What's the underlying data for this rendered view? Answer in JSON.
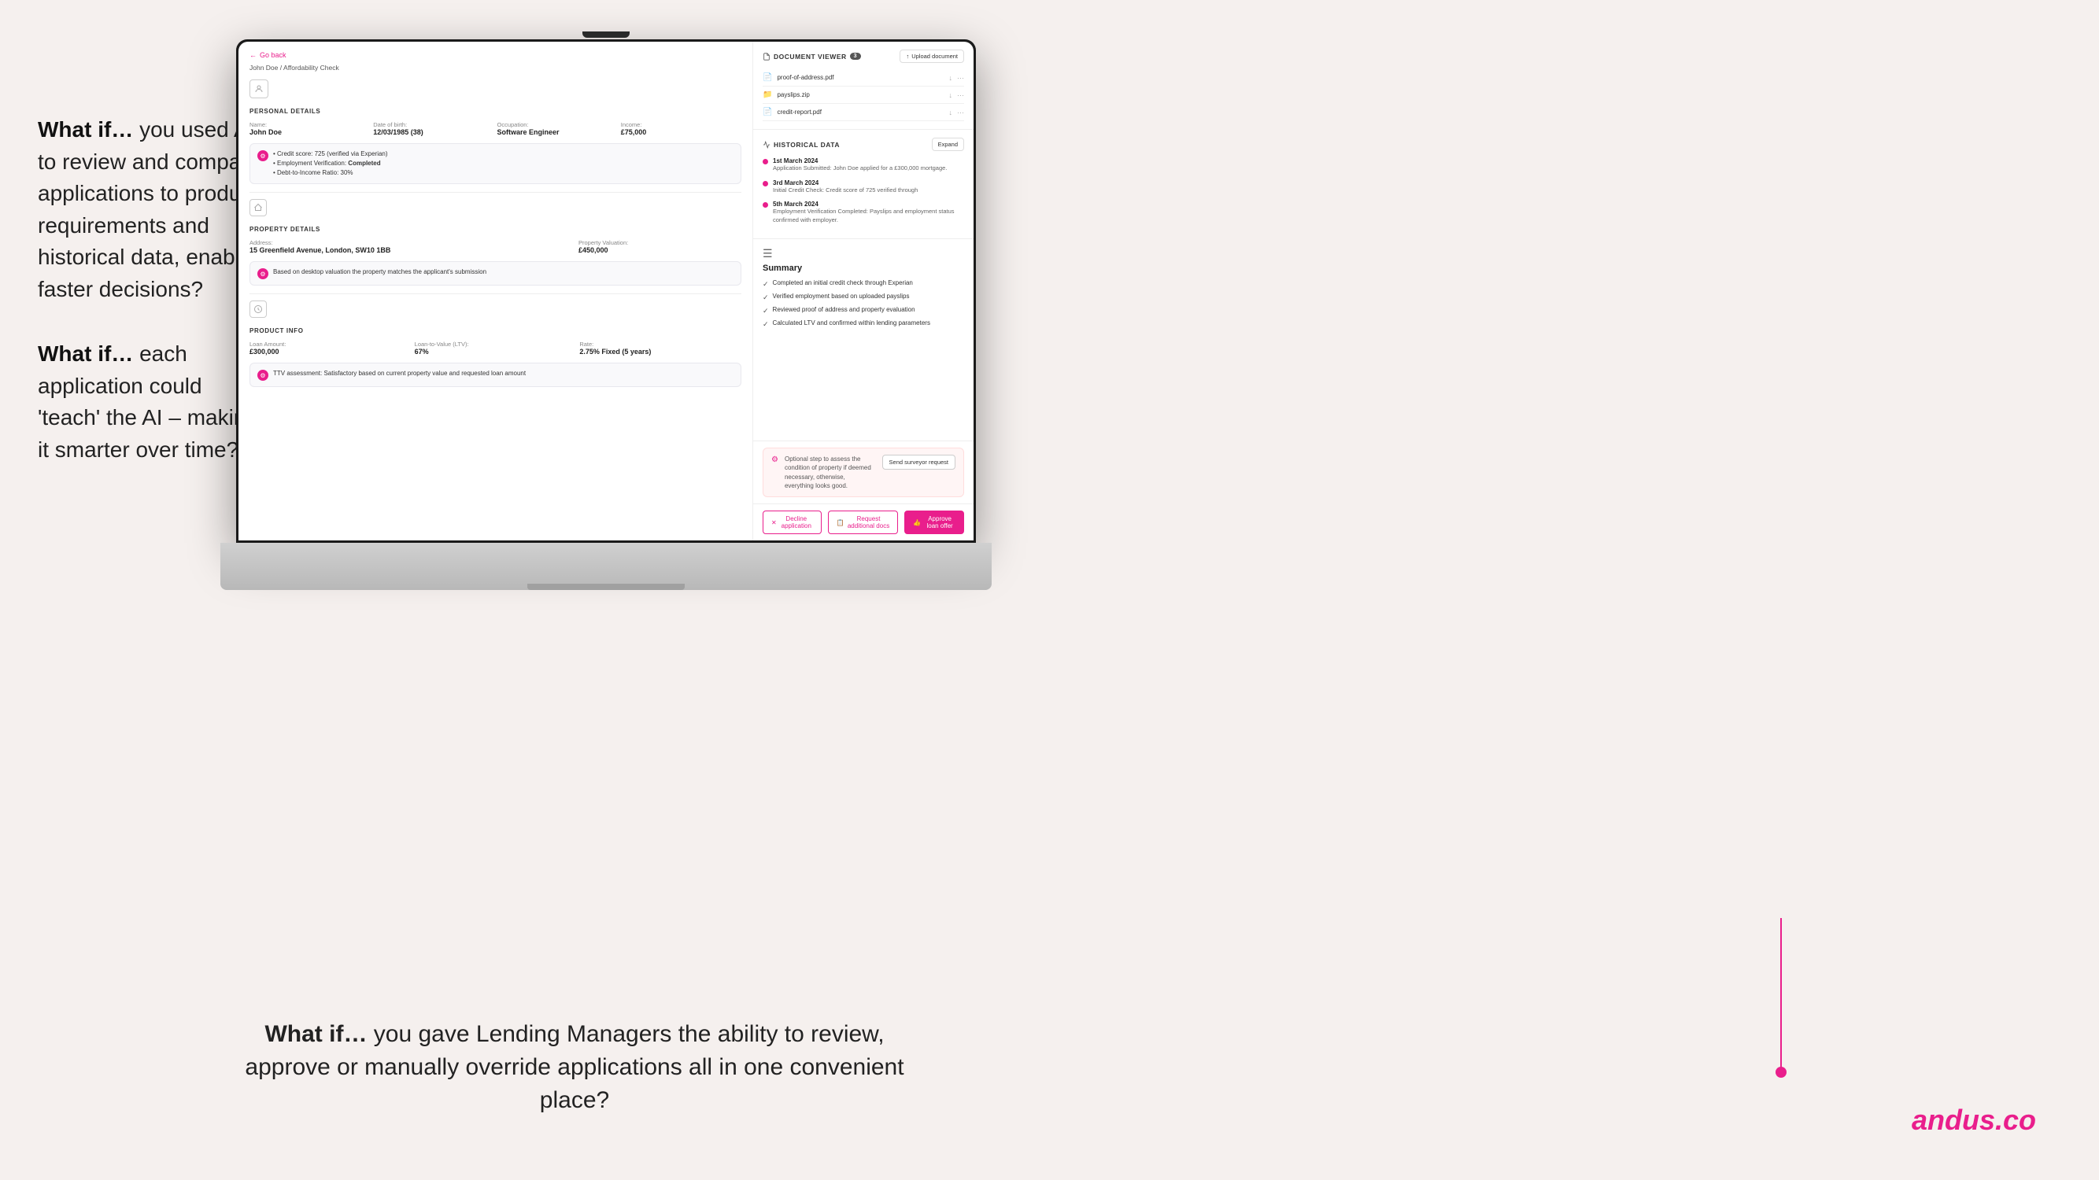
{
  "page": {
    "background_color": "#f5f0ee"
  },
  "left_text_1": {
    "prefix": "What if…",
    "body": " you used AI to review and compare applications to product requirements and historical data, enabling faster decisions?"
  },
  "left_text_2": {
    "prefix": "What if…",
    "body": " each application could 'teach' the AI – making it smarter over time?"
  },
  "bottom_text": {
    "prefix": "What if…",
    "body": " you gave Lending Managers the ability to review, approve or manually override applications all in one convenient place?"
  },
  "branding": "andus.co",
  "app": {
    "go_back": "Go back",
    "breadcrumb_home": "John Doe",
    "breadcrumb_separator": "/",
    "breadcrumb_current": "Affordability Check",
    "personal_details_title": "PERSONAL DETAILS",
    "personal": {
      "name_label": "Name:",
      "name_value": "John Doe",
      "dob_label": "Date of birth:",
      "dob_value": "12/03/1985 (38)",
      "occupation_label": "Occupation:",
      "occupation_value": "Software Engineer",
      "income_label": "Income:",
      "income_value": "£75,000"
    },
    "personal_insight": {
      "line1": "Credit score: 725 (verified via Experian)",
      "line2_prefix": "Employment Verification: ",
      "line2_bold": "Completed",
      "line3": "Debt-to-Income Ratio: 30%"
    },
    "property_details_title": "PROPERTY DETAILS",
    "property": {
      "address_label": "Address:",
      "address_value": "15 Greenfield Avenue, London, SW10 1BB",
      "valuation_label": "Property Valuation:",
      "valuation_value": "£450,000"
    },
    "property_insight": "Based on desktop valuation the property matches the applicant's submission",
    "product_info_title": "PRODUCT INFO",
    "product": {
      "loan_label": "Loan Amount:",
      "loan_value": "£300,000",
      "ltv_label": "Loan-to-Value (LTV):",
      "ltv_value": "67%",
      "rate_label": "Rate:",
      "rate_value": "2.75% Fixed (5 years)"
    },
    "product_insight": "TTV assessment: Satisfactory based on current property value and requested loan amount",
    "doc_viewer": {
      "title": "DOCUMENT VIEWER",
      "count": "3",
      "upload_btn": "Upload document",
      "docs": [
        {
          "name": "proof-of-address.pdf",
          "type": "pdf"
        },
        {
          "name": "payslips.zip",
          "type": "zip"
        },
        {
          "name": "credit-report.pdf",
          "type": "pdf"
        }
      ]
    },
    "historical_data": {
      "title": "HISTORICAL DATA",
      "expand_btn": "Expand",
      "items": [
        {
          "date": "1st March 2024",
          "desc": "Application Submitted: John Doe applied for a £300,000 mortgage."
        },
        {
          "date": "3rd March 2024",
          "desc": "Initial Credit Check: Credit score of 725 verified through"
        },
        {
          "date": "5th March 2024",
          "desc": "Employment Verification Completed: Payslips and employment status confirmed with employer."
        }
      ]
    },
    "summary": {
      "title": "Summary",
      "items": [
        "Completed an initial credit check through Experian",
        "Verified employment based on uploaded payslips",
        "Reviewed proof of address and property evaluation",
        "Calculated LTV and confirmed within lending parameters"
      ]
    },
    "survey_banner": {
      "text": "Optional step to assess the condition of property if deemed necessary, otherwise, everything looks good.",
      "btn": "Send surveyor request"
    },
    "actions": {
      "decline": "Decline application",
      "docs": "Request additional docs",
      "approve": "Approve loan offer"
    }
  }
}
